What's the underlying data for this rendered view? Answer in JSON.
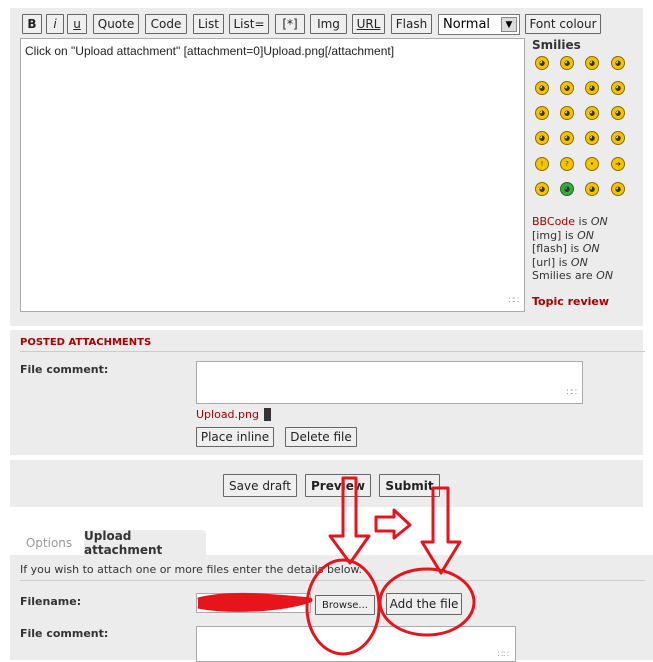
{
  "toolbar": {
    "buttons": [
      "B",
      "i",
      "u",
      "Quote",
      "Code",
      "List",
      "List=",
      "[*]",
      "Img",
      "URL",
      "Flash"
    ],
    "font_size_selected": "Normal",
    "font_colour": "Font colour"
  },
  "editor": {
    "text": "Click on \"Upload attachment\" [attachment=0]Upload.png[/attachment]"
  },
  "smilies": {
    "title": "Smilies"
  },
  "status": {
    "bbcode_label": "BBCode",
    "bbcode_is": " is ",
    "bbcode_val": "ON",
    "img_label": "[img] is ",
    "img_val": "ON",
    "flash_label": "[flash] is ",
    "flash_val": "ON",
    "url_label": "[url] is ",
    "url_val": "ON",
    "smilies_label": "Smilies are ",
    "smilies_val": "ON"
  },
  "topic_review": "Topic review",
  "posted_attachments": {
    "title": "POSTED ATTACHMENTS",
    "file_comment_label": "File comment:",
    "file_link": "Upload.png",
    "place_inline": "Place inline",
    "delete_file": "Delete file"
  },
  "submit": {
    "save_draft": "Save draft",
    "preview": "Preview",
    "submit": "Submit"
  },
  "tabs": {
    "options": "Options",
    "upload_attachment": "Upload attachment"
  },
  "upload": {
    "info": "If you wish to attach one or more files enter the details below.",
    "filename_label": "Filename:",
    "browse": "Browse...",
    "add_file": "Add the file",
    "file_comment_label": "File comment:"
  },
  "colors": {
    "accent_red": "#aa0000",
    "panel_bg": "#ececec",
    "annotation_red": "#e8141c"
  }
}
